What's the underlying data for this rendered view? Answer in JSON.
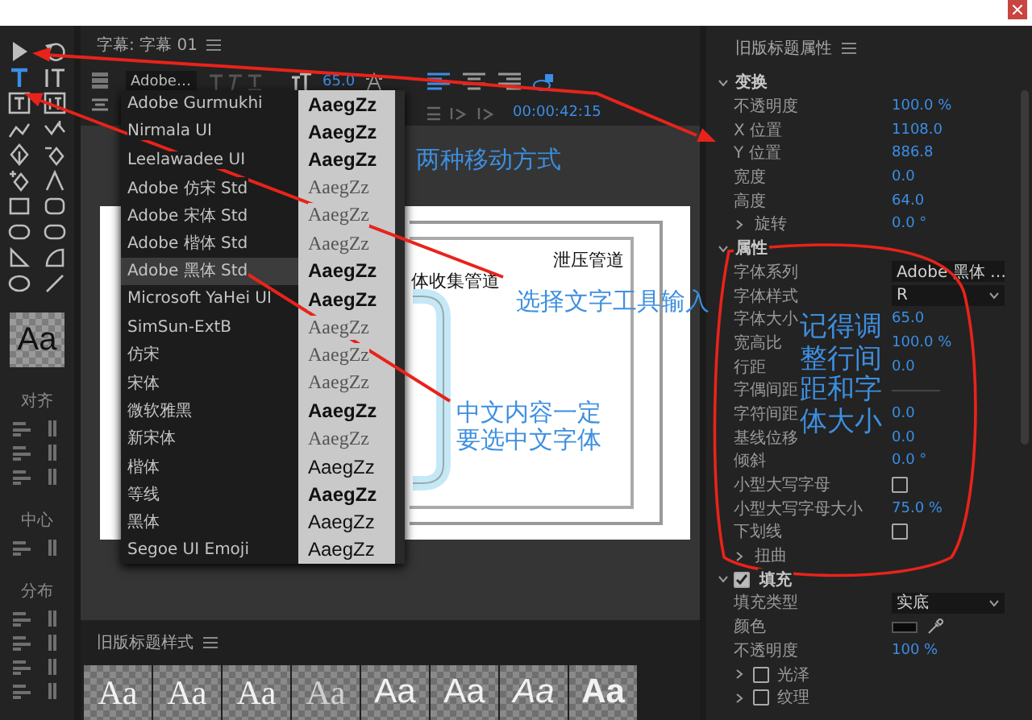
{
  "tools": [
    {
      "kind": "select",
      "selected": false
    },
    {
      "kind": "rotate",
      "selected": false
    },
    {
      "kind": "type",
      "selected": true
    },
    {
      "kind": "vertical-type",
      "selected": false
    },
    {
      "kind": "area-type",
      "selected": false
    },
    {
      "kind": "vertical-area-type",
      "selected": false
    },
    {
      "kind": "path-type",
      "selected": false
    },
    {
      "kind": "vertical-path-type",
      "selected": false
    },
    {
      "kind": "pen",
      "selected": false
    },
    {
      "kind": "delete-anchor",
      "selected": false
    },
    {
      "kind": "add-anchor",
      "selected": false
    },
    {
      "kind": "convert-anchor",
      "selected": false
    },
    {
      "kind": "rectangle",
      "selected": false
    },
    {
      "kind": "rounded-rectangle",
      "selected": false
    },
    {
      "kind": "oval-rectangle",
      "selected": false
    },
    {
      "kind": "rounded-corner-rectangle",
      "selected": false
    },
    {
      "kind": "wedge",
      "selected": false
    },
    {
      "kind": "arc",
      "selected": false
    },
    {
      "kind": "ellipse",
      "selected": false
    },
    {
      "kind": "line",
      "selected": false
    }
  ],
  "style_preview": "Aa",
  "align_sections": [
    {
      "label": "对齐"
    },
    {
      "label": "中心"
    },
    {
      "label": "分布"
    }
  ],
  "title_panel": {
    "title": "字幕: 字幕 01",
    "font_field": "Adobe…",
    "font_size": "65.0",
    "timecode": "00:00:42:15",
    "align": [
      {
        "selected": true
      },
      {
        "selected": false
      },
      {
        "selected": false
      }
    ]
  },
  "font_menu": {
    "items": [
      {
        "name": "Adobe Gurmukhi",
        "sample": "AaegZz",
        "kind": "bold",
        "selected": false
      },
      {
        "name": "Nirmala UI",
        "sample": "AaegZz",
        "kind": "bold",
        "selected": false
      },
      {
        "name": "Leelawadee UI",
        "sample": "AaegZz",
        "kind": "bold",
        "selected": false
      },
      {
        "name": "Adobe 仿宋 Std",
        "sample": "AaegZz",
        "kind": "serif",
        "selected": false
      },
      {
        "name": "Adobe 宋体 Std",
        "sample": "AaegZz",
        "kind": "serif",
        "selected": false
      },
      {
        "name": "Adobe 楷体 Std",
        "sample": "AaegZz",
        "kind": "serif",
        "selected": false
      },
      {
        "name": "Adobe 黑体 Std",
        "sample": "AaegZz",
        "kind": "bold",
        "selected": true
      },
      {
        "name": "Microsoft YaHei UI",
        "sample": "AaegZz",
        "kind": "bold",
        "selected": false
      },
      {
        "name": "SimSun-ExtB",
        "sample": "AaegZz",
        "kind": "serif",
        "selected": false
      },
      {
        "name": "仿宋",
        "sample": "AaegZz",
        "kind": "serif",
        "selected": false
      },
      {
        "name": "宋体",
        "sample": "AaegZz",
        "kind": "serif",
        "selected": false
      },
      {
        "name": "微软雅黑",
        "sample": "AaegZz",
        "kind": "bold",
        "selected": false
      },
      {
        "name": "新宋体",
        "sample": "AaegZz",
        "kind": "serif",
        "selected": false
      },
      {
        "name": "楷体",
        "sample": "AaegZz",
        "kind": "sans",
        "selected": false
      },
      {
        "name": "等线",
        "sample": "AaegZz",
        "kind": "bold",
        "selected": false
      },
      {
        "name": "黑体",
        "sample": "AaegZz",
        "kind": "sans",
        "selected": false
      },
      {
        "name": "Segoe UI Emoji",
        "sample": "AaegZz",
        "kind": "sans",
        "selected": false
      }
    ]
  },
  "canvas": {
    "labels": [
      "体收集管道",
      "泄压管道"
    ]
  },
  "styles_panel": {
    "title": "旧版标题样式",
    "tiles": [
      {
        "sample": "Aa",
        "kind": "serif"
      },
      {
        "sample": "Aa",
        "kind": "serif"
      },
      {
        "sample": "Aa",
        "kind": "serif"
      },
      {
        "sample": "Aa",
        "kind": "light"
      },
      {
        "sample": "Aa",
        "kind": "sans"
      },
      {
        "sample": "Aa",
        "kind": "sans"
      },
      {
        "sample": "Aa",
        "kind": "italic"
      },
      {
        "sample": "Aa",
        "kind": "bold"
      }
    ]
  },
  "properties_panel": {
    "title": "旧版标题属性",
    "sections": [
      {
        "title": "变换",
        "expanded": true,
        "rows": [
          {
            "kind": "value",
            "label": "不透明度",
            "value": "100.0 %"
          },
          {
            "kind": "value",
            "label": "X 位置",
            "value": "1108.0"
          },
          {
            "kind": "value",
            "label": "Y 位置",
            "value": "886.8"
          },
          {
            "kind": "value",
            "label": "宽度",
            "value": "0.0"
          },
          {
            "kind": "value",
            "label": "高度",
            "value": "64.0"
          },
          {
            "kind": "group",
            "label": "旋转",
            "value": "0.0 °",
            "expanded": false
          }
        ]
      },
      {
        "title": "属性",
        "expanded": true,
        "rows": [
          {
            "kind": "dropdown",
            "label": "字体系列",
            "value": "Adobe 黑体 …"
          },
          {
            "kind": "dropdown",
            "label": "字体样式",
            "value": "R"
          },
          {
            "kind": "value",
            "label": "字体大小",
            "value": "65.0"
          },
          {
            "kind": "value",
            "label": "宽高比",
            "value": "100.0 %"
          },
          {
            "kind": "value",
            "label": "行距",
            "value": "0.0"
          },
          {
            "kind": "blank",
            "label": "字偶间距"
          },
          {
            "kind": "value",
            "label": "字符间距",
            "value": "0.0"
          },
          {
            "kind": "value",
            "label": "基线位移",
            "value": "0.0"
          },
          {
            "kind": "value",
            "label": "倾斜",
            "value": "0.0 °"
          },
          {
            "kind": "checkbox",
            "label": "小型大写字母",
            "checked": false
          },
          {
            "kind": "value",
            "label": "小型大写字母大小",
            "value": "75.0 %"
          },
          {
            "kind": "checkbox",
            "label": "下划线",
            "checked": false
          },
          {
            "kind": "group",
            "label": "扭曲",
            "expanded": false
          }
        ]
      },
      {
        "title": "填充",
        "expanded": true,
        "checked": true,
        "rows": [
          {
            "kind": "dropdown",
            "label": "填充类型",
            "value": "实底"
          },
          {
            "kind": "color",
            "label": "颜色",
            "color": "#0a0a0a"
          },
          {
            "kind": "value",
            "label": "不透明度",
            "value": "100 %"
          },
          {
            "kind": "check-group",
            "label": "光泽",
            "checked": false,
            "expanded": false
          },
          {
            "kind": "check-group",
            "label": "纹理",
            "checked": false,
            "expanded": false
          }
        ]
      }
    ]
  },
  "annotations": [
    {
      "text": "两种移动方式"
    },
    {
      "text": "选择文字工具输入"
    },
    {
      "text": "中文内容一定要选中文字体"
    },
    {
      "text": "记得调整行间距和字体大小"
    }
  ]
}
